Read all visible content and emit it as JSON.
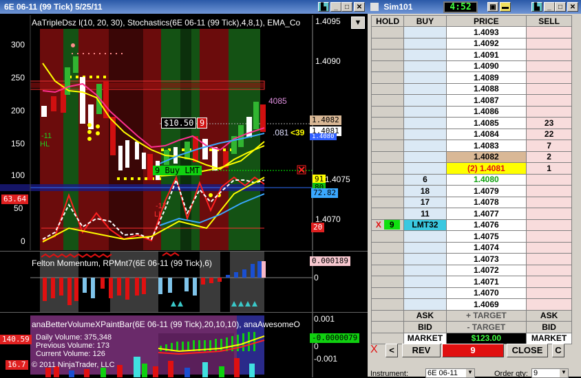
{
  "chart_window": {
    "title": "6E 06-11 (99 Tick)  5/25/11",
    "header_text": "AaTripleDsz l(10, 20, 30), Stochastics(6E 06-11 (99 Tick),4,8,1), EMA_Co",
    "left_axis": [
      "300",
      "250",
      "200",
      "150",
      "100",
      "50",
      "0"
    ],
    "right_axis": [
      "1.4095",
      "1.4090",
      "1.4075",
      "1.4070"
    ],
    "price_tags": {
      "t1": "1.4082",
      "t2": "1.4081",
      "t3": "1.4080",
      "t4": "91",
      "t5": "80",
      "t6": "72.82",
      "t7": "63.64",
      "t8": "20"
    },
    "left_labels": [
      "-11",
      "HL"
    ],
    "profit_label": "$10.50",
    "qty_label": "9",
    "order_label": "9   Buy LMT",
    "price_marker": "4085",
    "marker_4081": ".081",
    "marker_39": "<39",
    "bottom_markers": [
      "-17",
      "LL"
    ],
    "panel2": {
      "title": "Felton Momentum, RPMnt7(6E 06-11 (99 Tick),6)",
      "value_tag": "0.000189",
      "zero": "0"
    },
    "panel3": {
      "title": "anaBetterVolumeXPaintBar(6E 06-11 (99 Tick),20,10,10), anaAwesomeO",
      "daily_volume": "Daily Volume: 375,348",
      "previous_volume": "Previous Volume: 173",
      "current_volume": "Current Volume: 126",
      "copyright": "© 2011 NinjaTrader, LLC",
      "value_tag": "-0.0000079",
      "left_tag_1": "140.59",
      "left_tag_2": "16.7",
      "right_axis": [
        "0.001",
        "0",
        "-0.001"
      ]
    }
  },
  "dom_window": {
    "title": "Sim101",
    "clock": "4:52",
    "headers": {
      "hold": "HOLD",
      "buy": "BUY",
      "price": "PRICE",
      "sell": "SELL"
    },
    "rows": [
      {
        "buy": "",
        "price": "1.4093",
        "sell": ""
      },
      {
        "buy": "",
        "price": "1.4092",
        "sell": ""
      },
      {
        "buy": "",
        "price": "1.4091",
        "sell": ""
      },
      {
        "buy": "",
        "price": "1.4090",
        "sell": ""
      },
      {
        "buy": "",
        "price": "1.4089",
        "sell": ""
      },
      {
        "buy": "",
        "price": "1.4088",
        "sell": ""
      },
      {
        "buy": "",
        "price": "1.4087",
        "sell": ""
      },
      {
        "buy": "",
        "price": "1.4086",
        "sell": ""
      },
      {
        "buy": "",
        "price": "1.4085",
        "sell": "23"
      },
      {
        "buy": "",
        "price": "1.4084",
        "sell": "22"
      },
      {
        "buy": "",
        "price": "1.4083",
        "sell": "7"
      },
      {
        "buy": "",
        "price": "1.4082",
        "sell": "2"
      },
      {
        "buy": "",
        "price": "(2) 1.4081",
        "sell": "1"
      },
      {
        "buy": "6",
        "price": "1.4080",
        "sell": ""
      },
      {
        "buy": "18",
        "price": "1.4079",
        "sell": ""
      },
      {
        "buy": "17",
        "price": "1.4078",
        "sell": ""
      },
      {
        "buy": "11",
        "price": "1.4077",
        "sell": ""
      },
      {
        "buy": "LMT32",
        "price": "1.4076",
        "sell": ""
      },
      {
        "buy": "",
        "price": "1.4075",
        "sell": ""
      },
      {
        "buy": "",
        "price": "1.4074",
        "sell": ""
      },
      {
        "buy": "",
        "price": "1.4073",
        "sell": ""
      },
      {
        "buy": "",
        "price": "1.4072",
        "sell": ""
      },
      {
        "buy": "",
        "price": "1.4071",
        "sell": ""
      },
      {
        "buy": "",
        "price": "1.4070",
        "sell": ""
      },
      {
        "buy": "",
        "price": "1.4069",
        "sell": ""
      }
    ],
    "hold_x": "X",
    "hold_qty": "9",
    "ask_left": "ASK",
    "target_plus": "+ TARGET",
    "ask_right": "ASK",
    "bid_left": "BID",
    "target_minus": "- TARGET",
    "bid_right": "BID",
    "market_left": "MARKET",
    "pnl": "$123.00",
    "market_right": "MARKET",
    "x_label": "X",
    "back_button": "<",
    "rev_button": "REV",
    "qty_display": "9",
    "close_button": "CLOSE",
    "c_button": "C",
    "instrument_label": "Instrument:",
    "instrument_value": "6E 06-11",
    "order_qty_label": "Order qty:",
    "order_qty_value": "9"
  }
}
